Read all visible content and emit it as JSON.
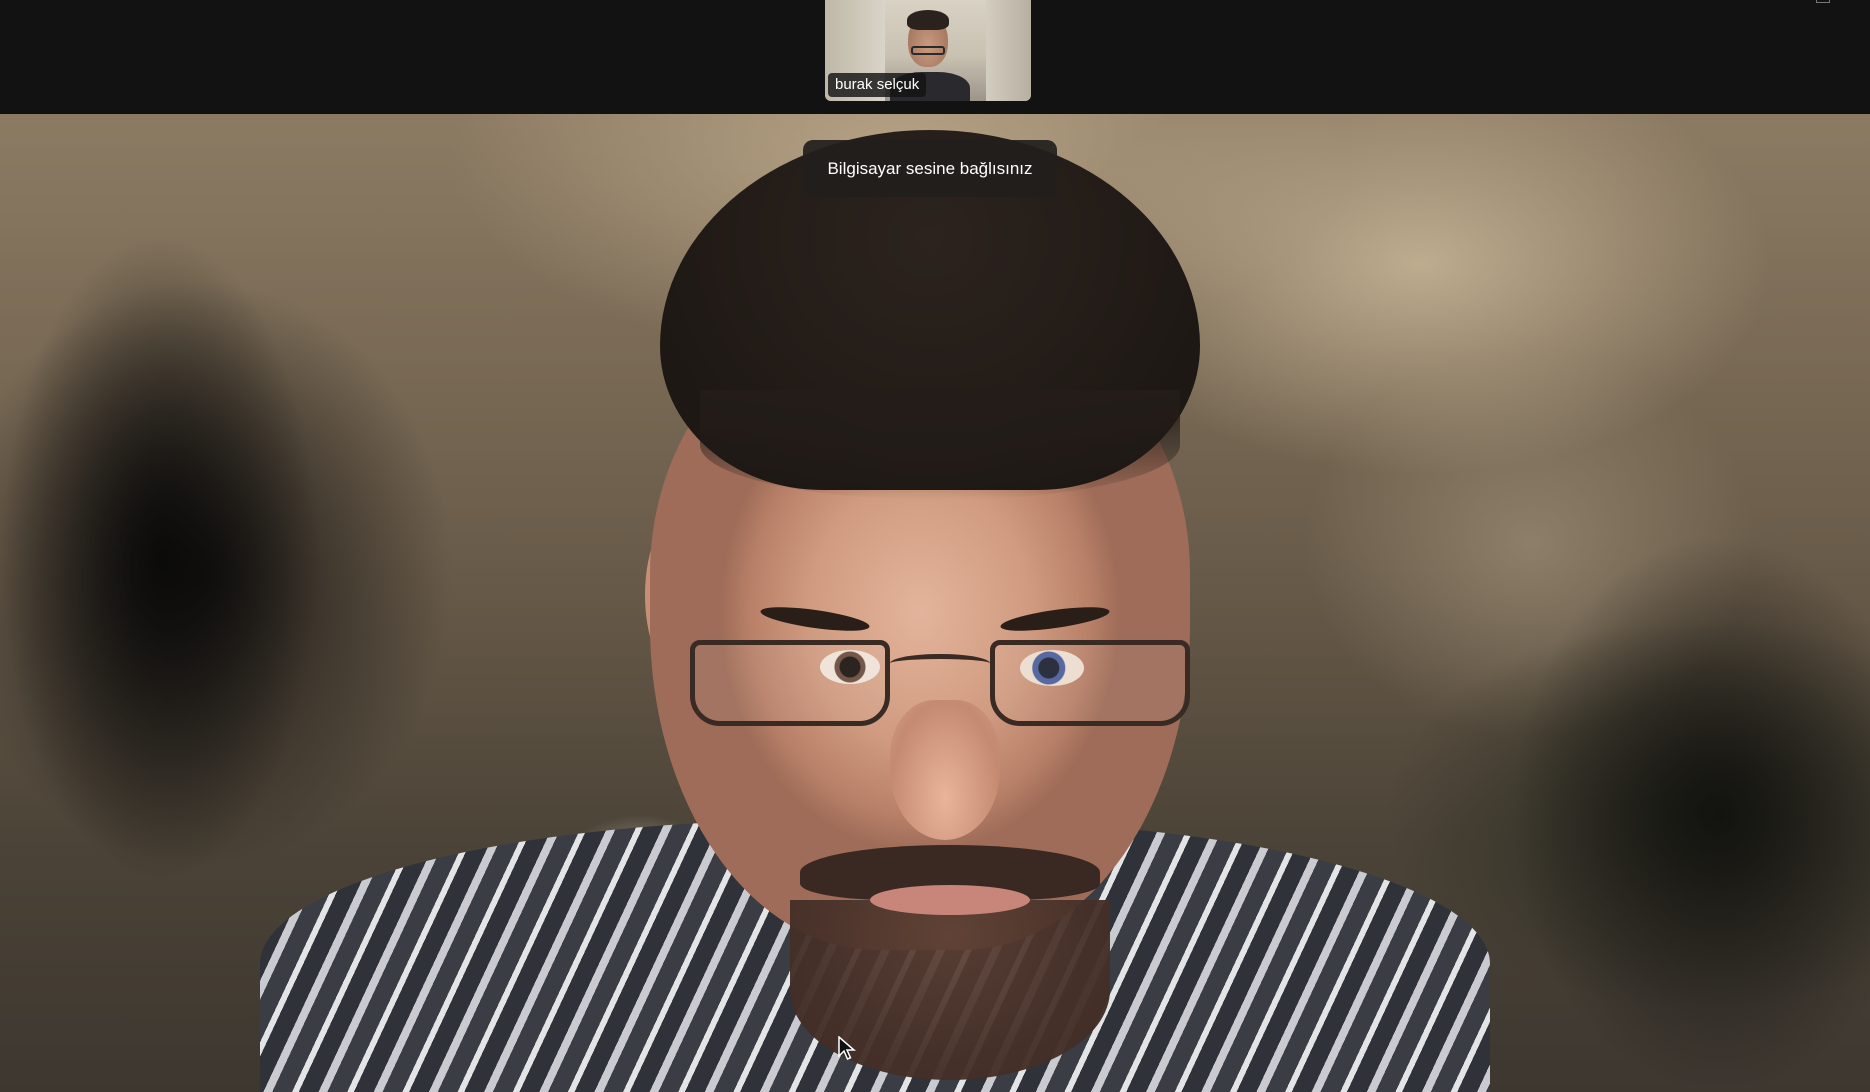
{
  "thumbnail": {
    "participant_name": "burak selçuk"
  },
  "notification": {
    "text": "Bilgisayar sesine bağlısınız"
  },
  "icons": {
    "cursor": "mouse-pointer-icon",
    "top_right": "window-control-icon"
  }
}
